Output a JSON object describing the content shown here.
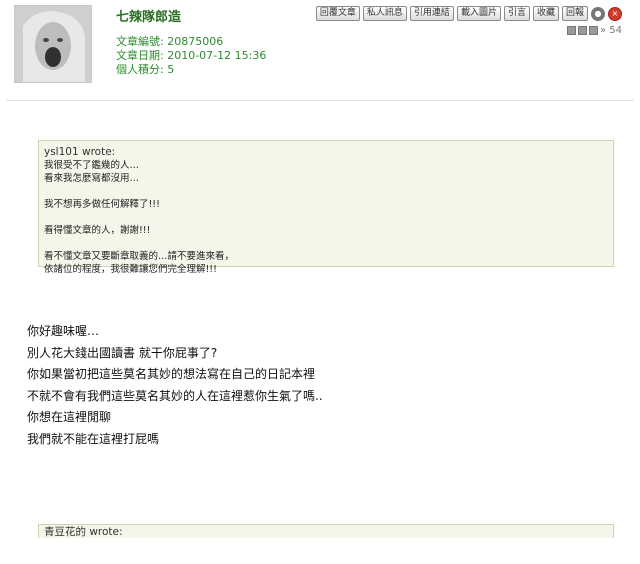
{
  "post": {
    "author": "七辣隊郎造",
    "meta": {
      "post_no": "文章編號: 20875006",
      "post_date": "文章日期: 2010-07-12 15:36",
      "points": "個人積分: 5"
    },
    "toolbar": [
      "回覆文章",
      "私人訊息",
      "引用連結",
      "載入圖片",
      "引言",
      "收藏",
      "回報"
    ],
    "icons": {
      "circle_gray": "gear-icon",
      "circle_red": "close-icon"
    },
    "floor": "» 54"
  },
  "quote1": {
    "author": "ysl101 wrote:",
    "lines": [
      "我很受不了鑑幾的人…",
      "看來我怎麼寫都沒用…",
      "",
      "我不想再多做任何解釋了!!!",
      "",
      "看得懂文章的人，謝謝!!!",
      "",
      "看不懂文章又要斷章取義的…請不要進來看，",
      "依諸位的程度，我很難讓您們完全理解!!!"
    ]
  },
  "reply": {
    "lines": [
      "你好趣味喔…",
      "別人花大錢出國讀書 就干你屁事了?",
      "你如果當初把這些莫名其妙的想法寫在自己的日記本裡",
      "不就不會有我們這些莫名其妙的人在這裡惹你生氣了嗎..",
      "你想在這裡閒聊",
      "我們就不能在這裡打屁嗎"
    ]
  },
  "quote2": {
    "author": "青豆花的 wrote:"
  },
  "colors": {
    "accent": "#2a6e24",
    "meta": "#2f8a2f",
    "quote_bg": "#f3f7ea"
  }
}
